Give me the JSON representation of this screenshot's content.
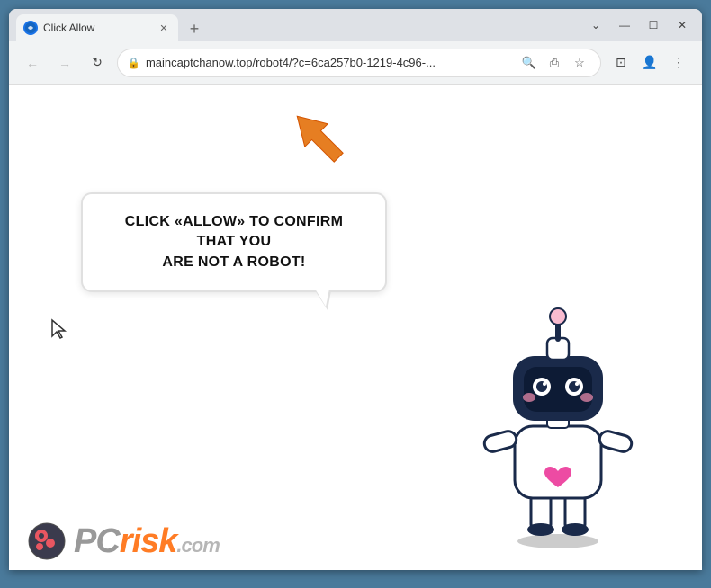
{
  "browser": {
    "tab": {
      "title": "Click Allow",
      "favicon_label": "C"
    },
    "address": {
      "url": "maincaptchanow.top/robot4/?c=6ca257b0-1219-4c96-...",
      "lock_symbol": "🔒"
    },
    "window_controls": {
      "minimize": "—",
      "maximize": "☐",
      "close": "✕",
      "chevron_down": "⌄"
    },
    "nav": {
      "back": "←",
      "forward": "→",
      "reload": "↻"
    },
    "toolbar": {
      "search": "🔍",
      "share": "⎙",
      "bookmark": "☆",
      "split": "⊡",
      "profile": "👤",
      "menu": "⋮"
    }
  },
  "page": {
    "bubble_text_line1": "CLICK «ALLOW» TO CONFIRM THAT YOU",
    "bubble_text_line2": "ARE NOT A ROBOT!",
    "watermark_pc": "PC",
    "watermark_risk": "risk",
    "watermark_dotcom": ".com"
  }
}
